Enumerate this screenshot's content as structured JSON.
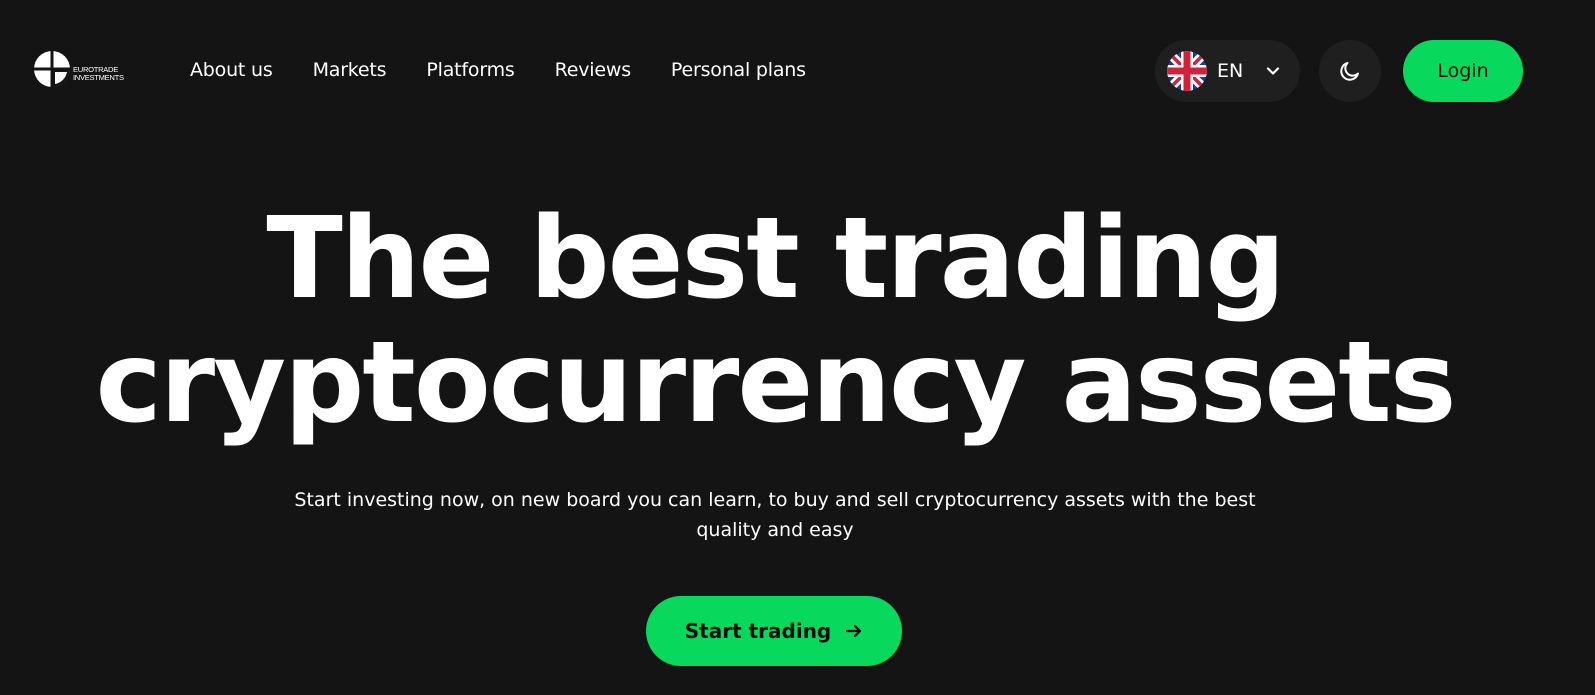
{
  "brand": {
    "line1": "EUROTRADE",
    "line2": "INVESTMENTS",
    "logo_icon": "logo-mark"
  },
  "nav": {
    "items": [
      {
        "label": "About us"
      },
      {
        "label": "Markets"
      },
      {
        "label": "Platforms"
      },
      {
        "label": "Reviews"
      },
      {
        "label": "Personal plans"
      }
    ]
  },
  "language": {
    "code": "EN",
    "flag_icon": "uk-flag-icon",
    "chevron_icon": "chevron-down-icon"
  },
  "theme_toggle": {
    "icon": "moon-icon"
  },
  "login": {
    "label": "Login"
  },
  "hero": {
    "title_line1": "The best trading",
    "title_line2": "cryptocurrency assets",
    "subtitle": "Start investing now, on new board you can learn, to buy and sell cryptocurrency assets with the best quality and easy",
    "cta_label": "Start trading",
    "cta_icon": "arrow-right-icon"
  },
  "colors": {
    "background": "#141414",
    "accent": "#08d85c",
    "pill_bg": "#1f1f1f",
    "text": "#ffffff"
  }
}
